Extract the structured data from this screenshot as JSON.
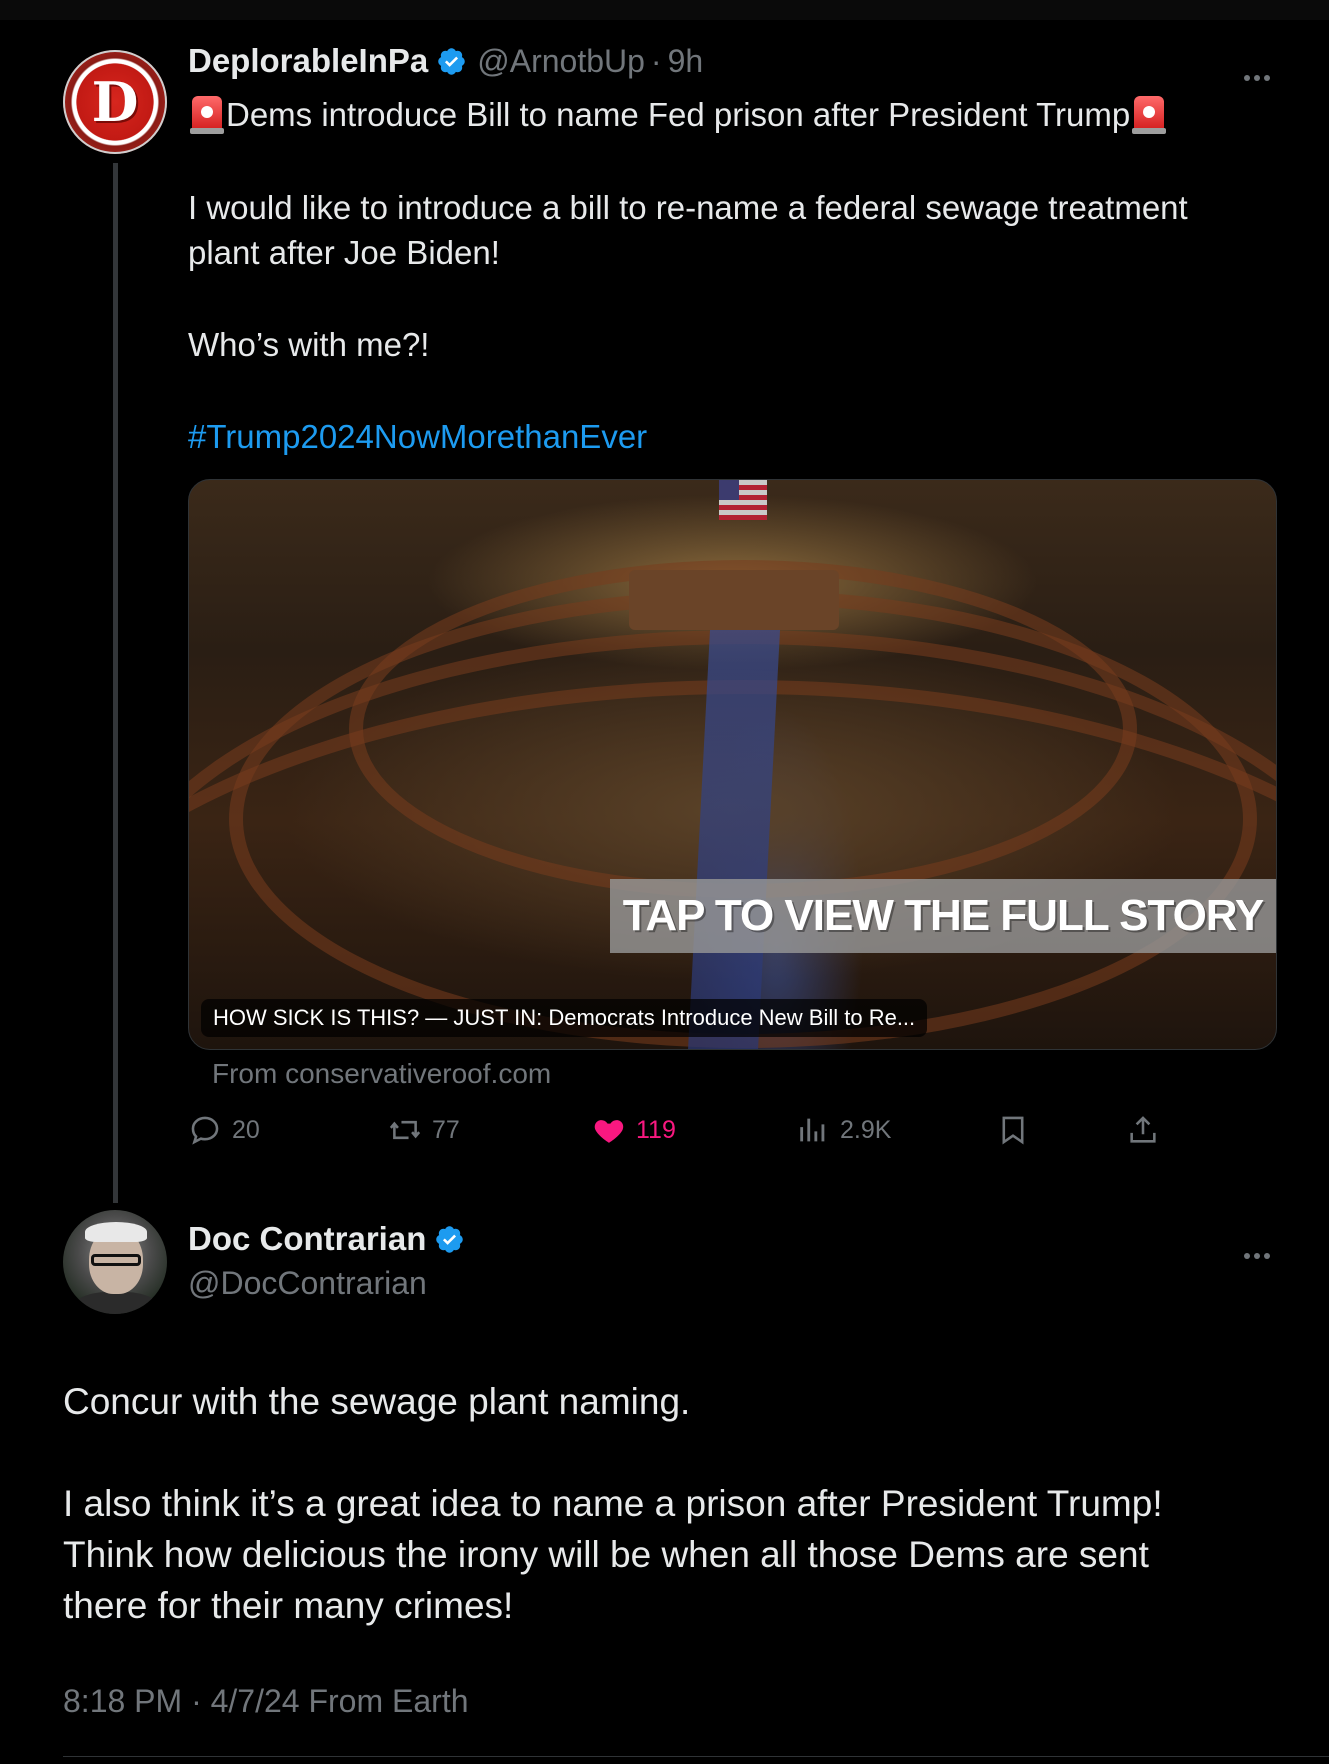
{
  "tweet1": {
    "avatar_letter": "D",
    "display_name": "DeplorableInPa",
    "handle": "@ArnotbUp",
    "separator": "·",
    "time": "9h",
    "headline": "Dems introduce Bill to name Fed prison after President Trump",
    "body_line1": "I would like to introduce a bill to re-name a federal sewage treatment",
    "body_line2": "plant after Joe Biden!",
    "body_line3": "Who’s with me?!",
    "hashtag": "#Trump2024NowMorethanEver",
    "card": {
      "banner": "TAP TO VIEW THE FULL STORY",
      "caption": "HOW SICK IS THIS? — JUST IN: Democrats Introduce New Bill to Re...",
      "from": "From conservativeroof.com"
    },
    "actions": {
      "replies": "20",
      "reposts": "77",
      "likes": "119",
      "views": "2.9K"
    }
  },
  "tweet2": {
    "display_name": "Doc Contrarian",
    "handle": "@DocContrarian",
    "line1": "Concur with the sewage plant naming.",
    "line2": "I also think it’s a great idea to name a prison after President Trump!",
    "line3": "Think how delicious the irony will be when all those Dems are sent",
    "line4": "there for their many crimes!",
    "meta": "8:18 PM · 4/7/24 From Earth"
  },
  "icons": [
    "verified-badge-icon",
    "more-icon",
    "siren-icon",
    "reply-icon",
    "repost-icon",
    "heart-icon",
    "views-icon",
    "bookmark-icon",
    "share-icon"
  ],
  "colors": {
    "background": "#000000",
    "text": "#e7e9ea",
    "secondary": "#71767b",
    "link": "#1d9bf0",
    "like": "#f91880",
    "verified": "#1d9bf0"
  }
}
